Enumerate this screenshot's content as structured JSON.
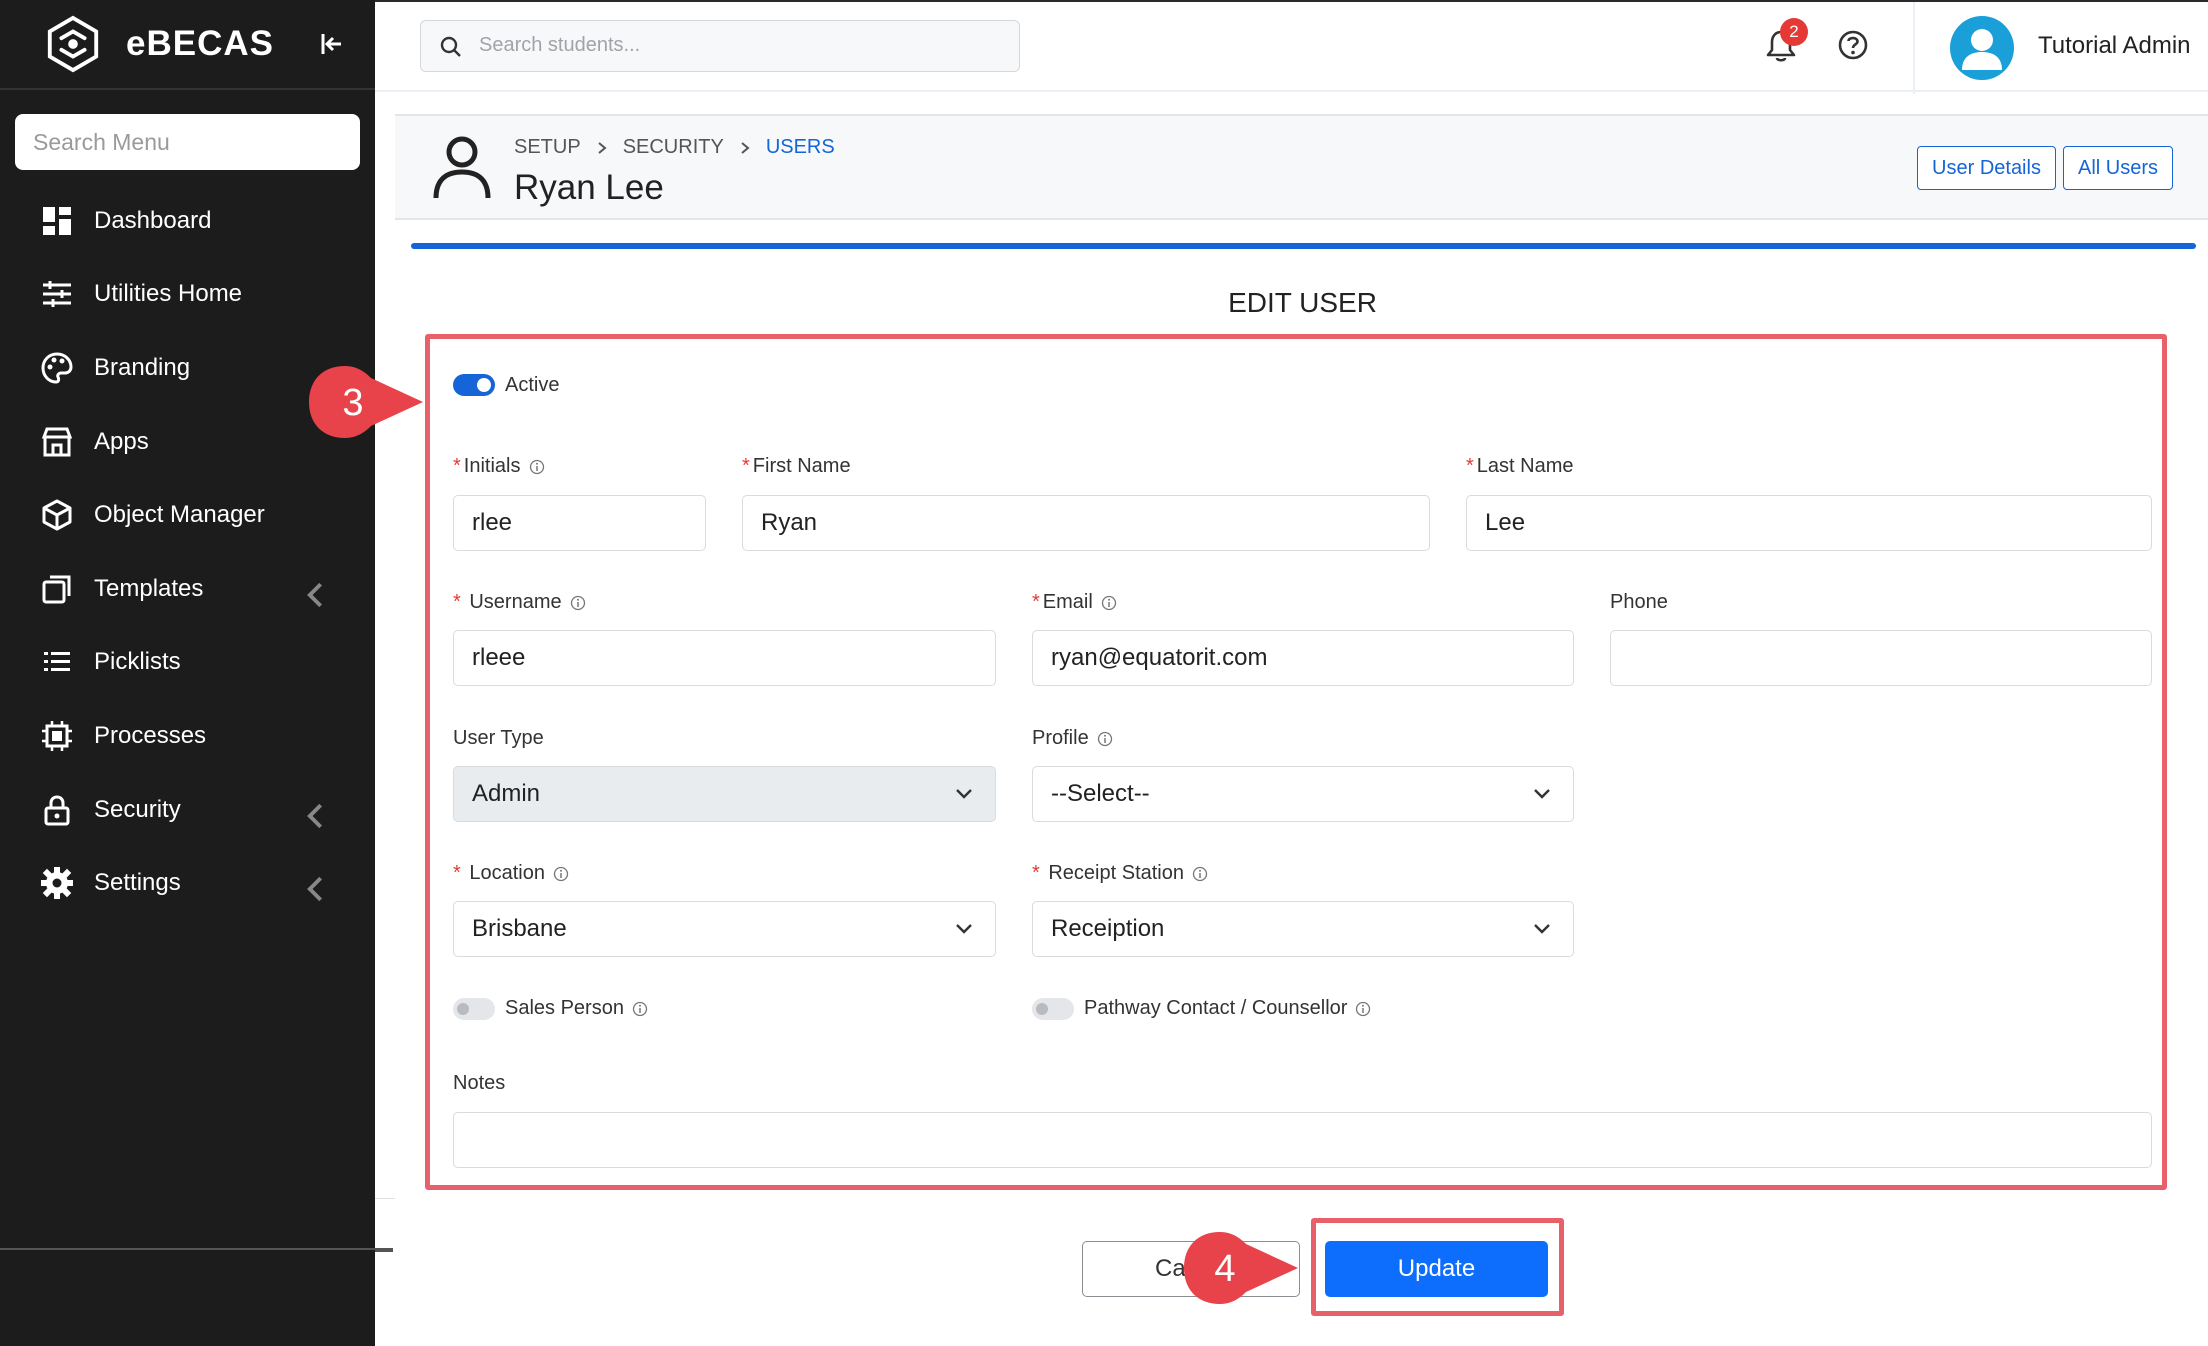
{
  "app": {
    "name": "eBECAS",
    "menu_search_placeholder": "Search Menu"
  },
  "sidebar": {
    "items": [
      {
        "label": "Dashboard",
        "icon": "dashboard-icon"
      },
      {
        "label": "Utilities Home",
        "icon": "sliders-icon"
      },
      {
        "label": "Branding",
        "icon": "palette-icon"
      },
      {
        "label": "Apps",
        "icon": "store-icon"
      },
      {
        "label": "Object Manager",
        "icon": "cube-icon"
      },
      {
        "label": "Templates",
        "icon": "templates-icon",
        "has_submenu": true
      },
      {
        "label": "Picklists",
        "icon": "list-icon"
      },
      {
        "label": "Processes",
        "icon": "chip-icon"
      },
      {
        "label": "Security",
        "icon": "lock-icon",
        "has_submenu": true
      },
      {
        "label": "Settings",
        "icon": "gear-icon",
        "has_submenu": true
      }
    ]
  },
  "topbar": {
    "search_placeholder": "Search students...",
    "notification_count": "2",
    "user_name": "Tutorial Admin"
  },
  "header": {
    "breadcrumb": [
      "SETUP",
      "SECURITY",
      "USERS"
    ],
    "title": "Ryan Lee",
    "user_details_label": "User Details",
    "all_users_label": "All Users"
  },
  "form": {
    "title": "EDIT USER",
    "active_label": "Active",
    "active": true,
    "initials": {
      "label": "Initials",
      "value": "rlee"
    },
    "first_name": {
      "label": "First Name",
      "value": "Ryan"
    },
    "last_name": {
      "label": "Last Name",
      "value": "Lee"
    },
    "username": {
      "label": "Username",
      "value": "rleee"
    },
    "email": {
      "label": "Email",
      "value": "ryan@equatorit.com"
    },
    "phone": {
      "label": "Phone",
      "value": ""
    },
    "user_type": {
      "label": "User Type",
      "value": "Admin"
    },
    "profile": {
      "label": "Profile",
      "value": "--Select--"
    },
    "location": {
      "label": "Location",
      "value": "Brisbane"
    },
    "receipt_station": {
      "label": "Receipt Station",
      "value": "Receiption"
    },
    "sales_person": {
      "label": "Sales Person",
      "checked": false
    },
    "pathway_contact": {
      "label": "Pathway Contact / Counsellor",
      "checked": false
    },
    "notes": {
      "label": "Notes",
      "value": ""
    },
    "cancel_label": "Ca",
    "update_label": "Update"
  },
  "callouts": {
    "step3": "3",
    "step4": "4"
  },
  "colors": {
    "sidebar_bg": "#1c1c1c",
    "primary": "#0d6efd",
    "highlight": "#e8606a",
    "avatar": "#1a9fd8"
  }
}
